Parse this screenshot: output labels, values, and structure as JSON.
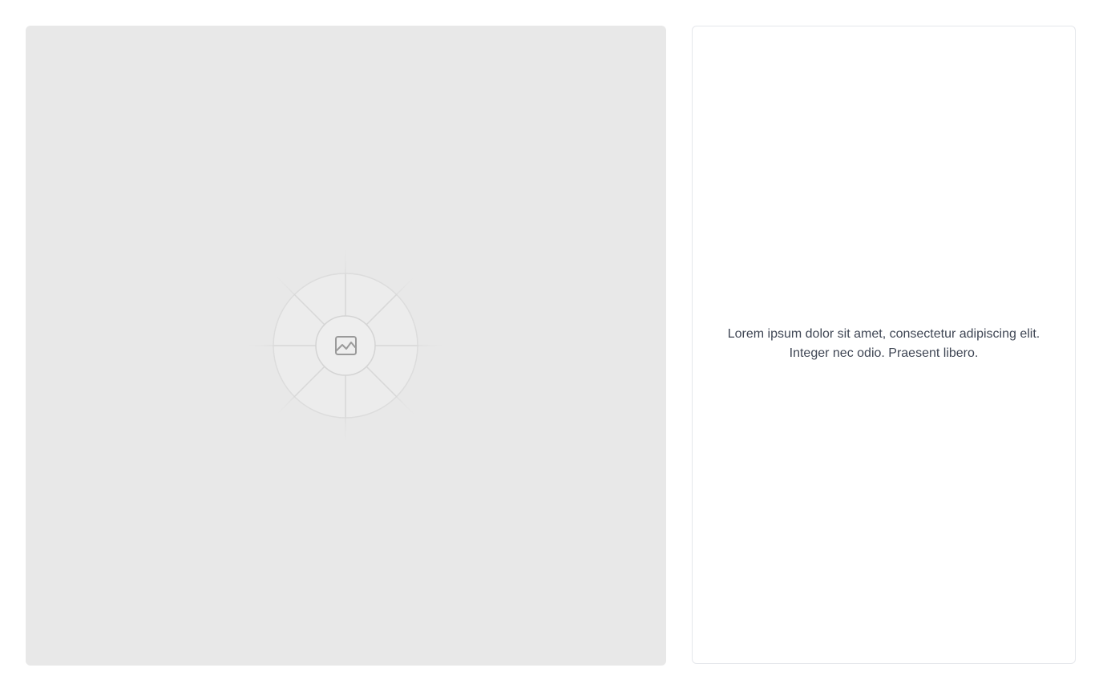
{
  "media": {
    "icon": "image-icon",
    "colors": {
      "background": "#e8e8e8",
      "ring": "#eeeeee",
      "line": "#d4d4d4",
      "icon": "#9a9a9a"
    }
  },
  "card": {
    "text": "Lorem ipsum dolor sit amet, consectetur adipiscing elit. Integer nec odio. Praesent libero.",
    "colors": {
      "text": "#3f4654",
      "border": "#e5e7eb"
    }
  }
}
